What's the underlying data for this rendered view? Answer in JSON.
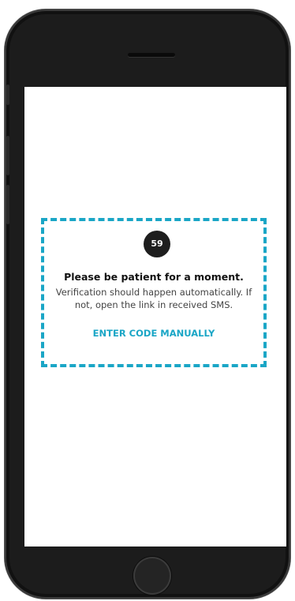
{
  "verification": {
    "countdown": "59",
    "title": "Please be patient for a moment.",
    "message": "Verification should happen automatically. If not, open the link in received SMS.",
    "enter_code_label": "ENTER CODE MANUALLY"
  },
  "colors": {
    "accent": "#1aa6c6",
    "timer_bg": "#1e1e1e",
    "device_frame": "#1c1c1c"
  }
}
